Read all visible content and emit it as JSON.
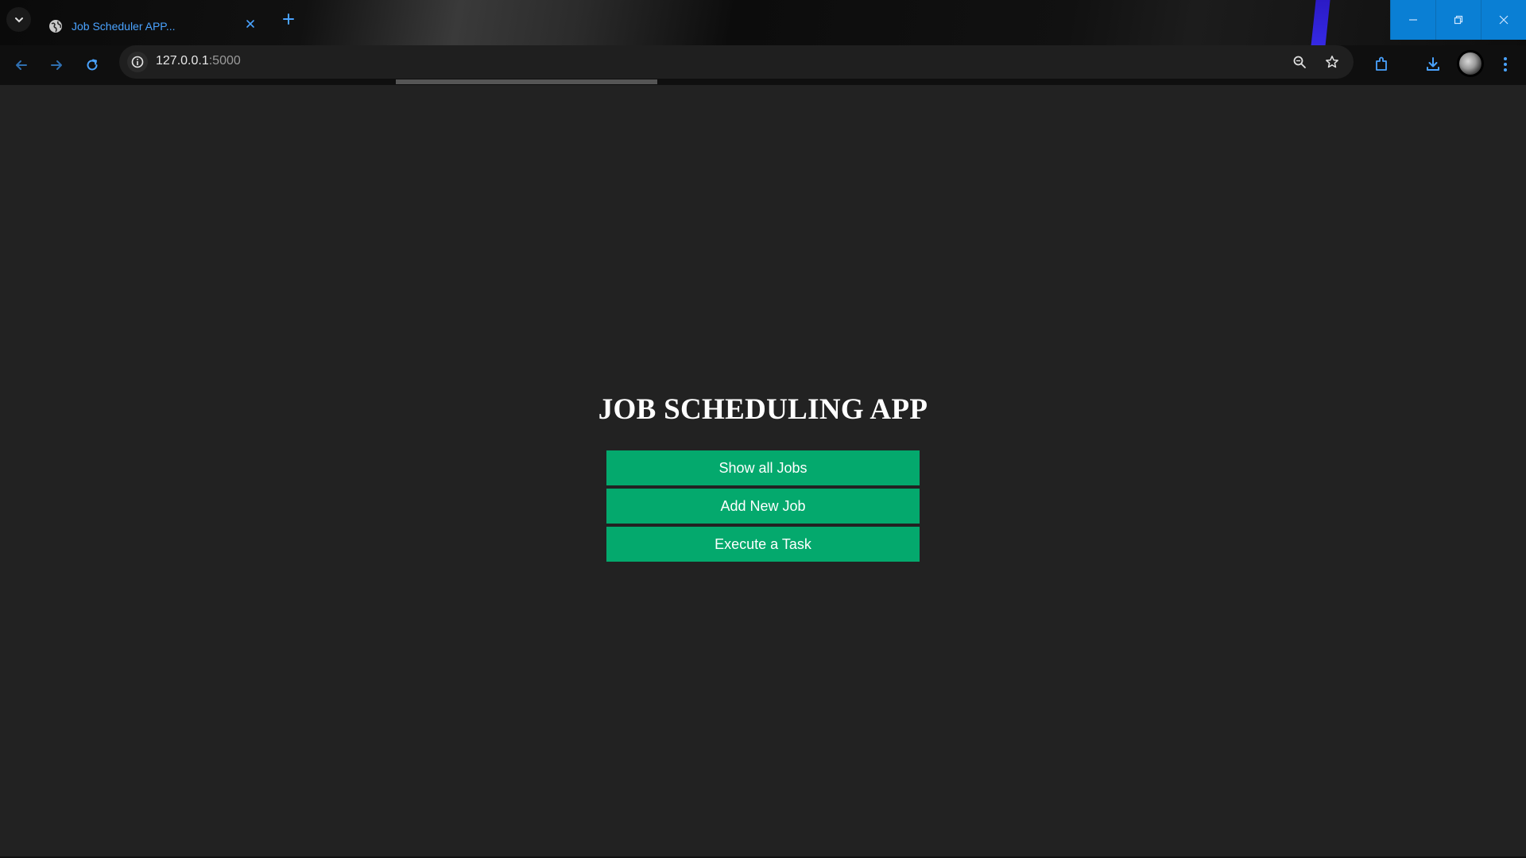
{
  "browser": {
    "tab": {
      "title": "Job Scheduler APP...",
      "favicon": "globe-icon",
      "close_icon": "close-icon"
    },
    "new_tab_icon": "plus-icon",
    "tab_search_icon": "chevron-down-icon",
    "window_controls": [
      "minimize-icon",
      "restore-icon",
      "close-icon"
    ],
    "nav": {
      "back_icon": "arrow-left-icon",
      "forward_icon": "arrow-right-icon",
      "reload_icon": "reload-icon"
    },
    "address_bar": {
      "host": "127.0.0.1",
      "port": ":5000",
      "site_info_icon": "info-icon",
      "zoom_icon": "zoom-icon",
      "bookmark_icon": "star-icon"
    },
    "toolbar_icons": [
      "extensions-icon",
      "download-icon",
      "avatar",
      "more-vert-icon"
    ],
    "accent_color": "#0a7fd4"
  },
  "page": {
    "title": "JOB SCHEDULING APP",
    "buttons": [
      {
        "label": "Show all Jobs"
      },
      {
        "label": "Add New Job"
      },
      {
        "label": "Execute a Task"
      }
    ],
    "background_color": "#222222",
    "button_color": "#04a96d"
  }
}
